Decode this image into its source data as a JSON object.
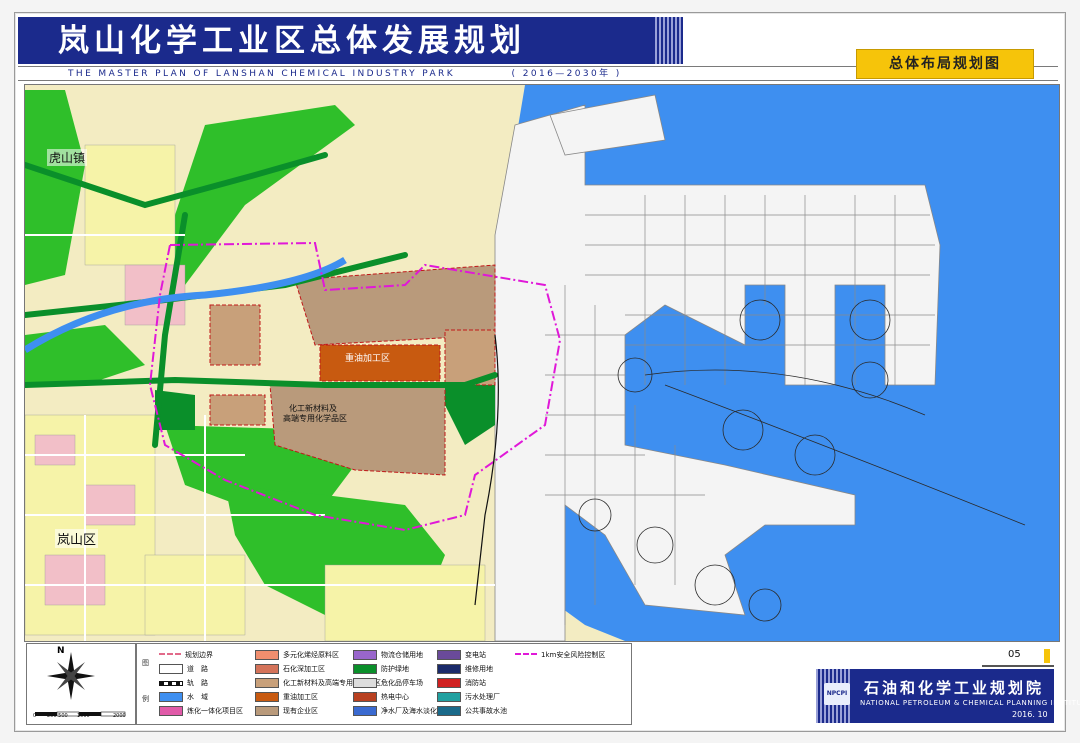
{
  "header": {
    "title_cn": "岚山化学工业区总体发展规划",
    "title_en": "THE MASTER PLAN OF LANSHAN CHEMICAL INDUSTRY PARK",
    "period": "( 2016—2030年 )",
    "sheet_name": "总体布局规划图"
  },
  "map_labels": {
    "town_hushan": "虎山镇",
    "district_lanshan": "岚山区",
    "zone_heavy": "重油加工区",
    "zone_new_material_1": "化工新材料及",
    "zone_new_material_2": "高端专用化学品区"
  },
  "colors": {
    "sea": "#3e8ff0",
    "green": "#2fbf2a",
    "dark_green": "#0a8f2a",
    "brown": "#b99a7b",
    "orange": "#c85a10",
    "yellow": "#f6f3a8",
    "pink": "#f2bfc8",
    "boundary": "#e018d8",
    "title_blue": "#1b2a8c",
    "badge_yellow": "#f6c40a"
  },
  "legend": {
    "side_labels": [
      "图",
      "例"
    ],
    "items": [
      {
        "label": "规划边界",
        "color": "#ffffff",
        "kind": "boundary"
      },
      {
        "label": "道　路",
        "color": "#ffffff",
        "kind": "road"
      },
      {
        "label": "轨　路",
        "color": "#ffffff",
        "kind": "rail"
      },
      {
        "label": "水　域",
        "color": "#3e8ff0",
        "kind": "fill"
      },
      {
        "label": "炼化一体化项目区",
        "color": "#e05aa8",
        "kind": "fill"
      },
      {
        "label": "多元化烯烃原料区",
        "color": "#f08e6e",
        "kind": "fill"
      },
      {
        "label": "石化深加工区",
        "color": "#d4735a",
        "kind": "fill"
      },
      {
        "label": "化工新材料及高端专用化学品区",
        "color": "#c8a07a",
        "kind": "fill"
      },
      {
        "label": "重油加工区",
        "color": "#c85a10",
        "kind": "fill"
      },
      {
        "label": "现有企业区",
        "color": "#b99a7b",
        "kind": "fill"
      },
      {
        "label": "物流仓储用地",
        "color": "#9966cc",
        "kind": "fill"
      },
      {
        "label": "防护绿地",
        "color": "#0a8f2a",
        "kind": "fill"
      },
      {
        "label": "危化品停车场",
        "color": "#dddddd",
        "kind": "fill"
      },
      {
        "label": "热电中心",
        "color": "#b84020",
        "kind": "fill"
      },
      {
        "label": "净水厂及海水淡化",
        "color": "#3a6ad0",
        "kind": "fill"
      },
      {
        "label": "变电站",
        "color": "#6a4a9a",
        "kind": "fill"
      },
      {
        "label": "维修用地",
        "color": "#1a2a6a",
        "kind": "fill"
      },
      {
        "label": "消防站",
        "color": "#d02020",
        "kind": "fill"
      },
      {
        "label": "污水处理厂",
        "color": "#20a0a0",
        "kind": "fill"
      },
      {
        "label": "公共事故水池",
        "color": "#1a6a8a",
        "kind": "fill"
      },
      {
        "label": "1km安全风险控制区",
        "color": "#e018d8",
        "kind": "boundary"
      }
    ]
  },
  "scale": {
    "labels": [
      "0",
      "200 500",
      "1000",
      "2000"
    ]
  },
  "compass_label": "N",
  "footer": {
    "page": "05",
    "institute_cn": "石油和化学工业规划院",
    "institute_en": "NATIONAL PETROLEUM & CHEMICAL PLANNING INSTITUTE",
    "logo_text": "NPCPI",
    "date": "2016. 10"
  }
}
